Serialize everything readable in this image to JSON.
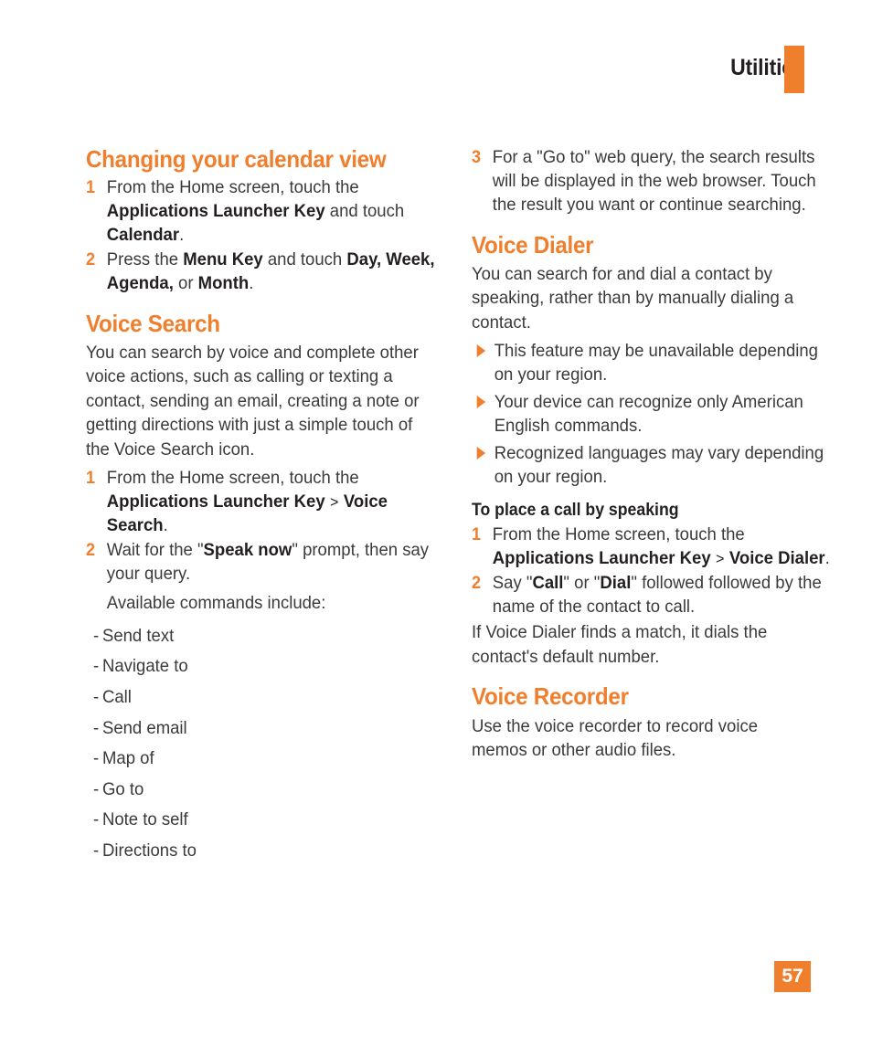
{
  "header": {
    "title": "Utilities",
    "accent_color": "#F07F2D"
  },
  "page_number": "57",
  "left_column": {
    "calendar_section": {
      "title": "Changing your calendar view",
      "steps": [
        {
          "num": "1",
          "parts": [
            {
              "text": "From the Home screen, touch the ",
              "style": "normal"
            },
            {
              "text": "Applications Launcher Key",
              "style": "bold"
            },
            {
              "text": " and touch ",
              "style": "normal"
            },
            {
              "text": "Calendar",
              "style": "bold"
            },
            {
              "text": ".",
              "style": "normal"
            }
          ]
        },
        {
          "num": "2",
          "parts": [
            {
              "text": "Press the ",
              "style": "normal"
            },
            {
              "text": "Menu Key",
              "style": "bold"
            },
            {
              "text": " and touch ",
              "style": "normal"
            },
            {
              "text": "Day, Week, Agenda,",
              "style": "bold"
            },
            {
              "text": " or ",
              "style": "normal"
            },
            {
              "text": "Month",
              "style": "bold"
            },
            {
              "text": ".",
              "style": "normal"
            }
          ]
        }
      ]
    },
    "voice_search_section": {
      "title": "Voice Search",
      "intro": "You can search by voice and complete other voice actions, such as calling or texting a contact, sending an email, creating a note or getting directions with just a simple touch of the Voice Search icon.",
      "steps": [
        {
          "num": "1",
          "parts": [
            {
              "text": "From the Home screen, touch the ",
              "style": "normal"
            },
            {
              "text": "Applications Launcher Key",
              "style": "bold"
            },
            {
              "text": " > ",
              "style": "gt"
            },
            {
              "text": "Voice Search",
              "style": "bold"
            },
            {
              "text": ".",
              "style": "normal"
            }
          ]
        },
        {
          "num": "2",
          "parts": [
            {
              "text": "Wait for the \"",
              "style": "normal"
            },
            {
              "text": "Speak now",
              "style": "bold"
            },
            {
              "text": "\" prompt, then say your query.",
              "style": "normal"
            }
          ]
        }
      ],
      "commands_intro": "Available commands include:",
      "commands": [
        "Send text",
        "Navigate to",
        "Call",
        "Send email",
        "Map of",
        "Go to",
        "Note to self",
        "Directions to"
      ],
      "dash": "-"
    }
  },
  "right_column": {
    "continued_step": {
      "num": "3",
      "parts": [
        {
          "text": "For a \"Go to\" web query, the search results will be displayed in the web browser. Touch the result you want or continue searching.",
          "style": "normal"
        }
      ]
    },
    "voice_dialer_section": {
      "title": "Voice Dialer",
      "intro": "You can search for and dial a contact by speaking, rather than by manually dialing a contact.",
      "notes": [
        "This feature may be unavailable depending on your region.",
        "Your device can recognize only American English commands.",
        "Recognized languages may vary depending on your region."
      ],
      "subtitle": "To place a call by speaking",
      "steps": [
        {
          "num": "1",
          "parts": [
            {
              "text": "From the Home screen, touch the ",
              "style": "normal"
            },
            {
              "text": "Applications Launcher Key",
              "style": "bold"
            },
            {
              "text": " > ",
              "style": "gt"
            },
            {
              "text": "Voice Dialer",
              "style": "bold"
            },
            {
              "text": ".",
              "style": "normal"
            }
          ]
        },
        {
          "num": "2",
          "parts": [
            {
              "text": "Say \"",
              "style": "normal"
            },
            {
              "text": "Call",
              "style": "bold"
            },
            {
              "text": "\" or \"",
              "style": "normal"
            },
            {
              "text": "Dial",
              "style": "bold"
            },
            {
              "text": "\" followed followed by the name of the contact to call.",
              "style": "normal"
            }
          ]
        }
      ],
      "outro": "If Voice Dialer finds a match, it dials the contact's default number."
    },
    "voice_recorder_section": {
      "title": "Voice Recorder",
      "intro": "Use the voice recorder to record voice memos or other audio files."
    }
  }
}
